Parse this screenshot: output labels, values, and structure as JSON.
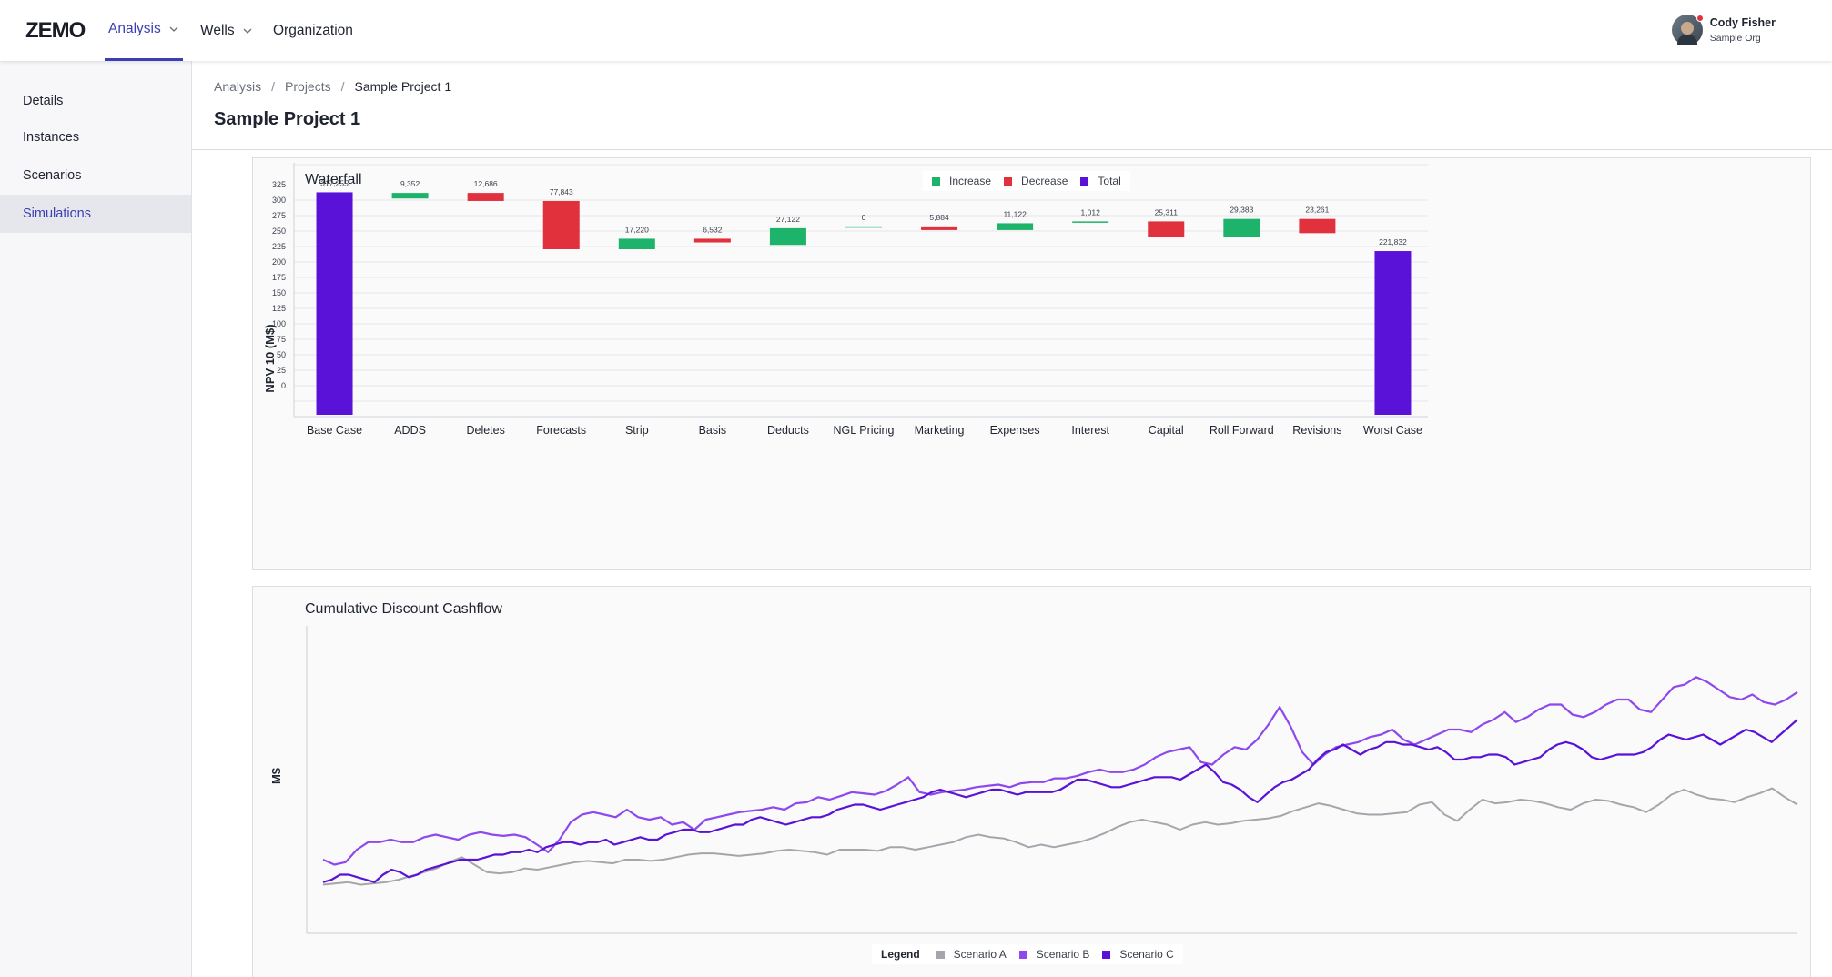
{
  "app": {
    "logo_text": "ZEMO"
  },
  "nav": {
    "analysis": "Analysis",
    "wells": "Wells",
    "organization": "Organization"
  },
  "user": {
    "name": "Cody Fisher",
    "org": "Sample Org"
  },
  "sidebar": {
    "items": [
      {
        "label": "Details"
      },
      {
        "label": "Instances"
      },
      {
        "label": "Scenarios"
      },
      {
        "label": "Simulations"
      }
    ]
  },
  "breadcrumb": {
    "items": [
      "Analysis",
      "Projects",
      "Sample Project 1"
    ],
    "separator": "/"
  },
  "page": {
    "title": "Sample Project 1"
  },
  "colors": {
    "increase": "#1eb36a",
    "decrease": "#e0313c",
    "total": "#5b12d8",
    "scenario_a": "#a4a6ac",
    "scenario_b": "#8e48ee",
    "scenario_c": "#5b12d8",
    "accent": "#3b3fb3"
  },
  "chart_data": [
    {
      "type": "bar",
      "subtype": "waterfall",
      "title": "Waterfall",
      "ylabel": "NPV 10 (M$)",
      "ylim": [
        -25,
        350
      ],
      "yticks": [
        0,
        25,
        50,
        75,
        100,
        125,
        150,
        175,
        200,
        225,
        250,
        275,
        300,
        325
      ],
      "grid": true,
      "legend": {
        "position": "top-center",
        "items": [
          "Increase",
          "Decrease",
          "Total"
        ]
      },
      "categories": [
        "Base Case",
        "ADDS",
        "Deletes",
        "Forecasts",
        "Strip",
        "Basis",
        "Deducts",
        "NGL Pricing",
        "Marketing",
        "Expenses",
        "Interest",
        "Capital",
        "Roll Forward",
        "Revisions",
        "Worst Case"
      ],
      "bars": [
        {
          "category": "Base Case",
          "kind": "Total",
          "start": -20,
          "end": 317,
          "label": "317,255"
        },
        {
          "category": "ADDS",
          "kind": "Increase",
          "start": 307,
          "end": 316,
          "label": "9,352"
        },
        {
          "category": "Deletes",
          "kind": "Decrease",
          "start": 316,
          "end": 303,
          "label": "12,686"
        },
        {
          "category": "Forecasts",
          "kind": "Decrease",
          "start": 303,
          "end": 225,
          "label": "77,843"
        },
        {
          "category": "Strip",
          "kind": "Increase",
          "start": 225,
          "end": 242,
          "label": "17,220"
        },
        {
          "category": "Basis",
          "kind": "Decrease",
          "start": 242,
          "end": 236,
          "label": "6,532"
        },
        {
          "category": "Deducts",
          "kind": "Increase",
          "start": 232,
          "end": 259,
          "label": "27,122"
        },
        {
          "category": "NGL Pricing",
          "kind": "Increase",
          "start": 262,
          "end": 262,
          "label": "0"
        },
        {
          "category": "Marketing",
          "kind": "Decrease",
          "start": 262,
          "end": 256,
          "label": "5,884"
        },
        {
          "category": "Expenses",
          "kind": "Increase",
          "start": 256,
          "end": 267,
          "label": "11,122"
        },
        {
          "category": "Interest",
          "kind": "Increase",
          "start": 269,
          "end": 270,
          "label": "1,012"
        },
        {
          "category": "Capital",
          "kind": "Decrease",
          "start": 270,
          "end": 245,
          "label": "25,311"
        },
        {
          "category": "Roll Forward",
          "kind": "Increase",
          "start": 245,
          "end": 274,
          "label": "29,383"
        },
        {
          "category": "Revisions",
          "kind": "Decrease",
          "start": 274,
          "end": 251,
          "label": "23,261"
        },
        {
          "category": "Worst Case",
          "kind": "Total",
          "start": -20,
          "end": 222,
          "label": "221,832"
        }
      ]
    },
    {
      "type": "line",
      "title": "Cumulative Discount Cashflow",
      "ylabel": "M$",
      "xlabel": "",
      "ylim": [
        0,
        100
      ],
      "grid": false,
      "legend": {
        "position": "bottom-center",
        "title": "Legend",
        "items": [
          "Scenario A",
          "Scenario B",
          "Scenario C"
        ]
      },
      "series": [
        {
          "name": "Scenario A",
          "values": [
            10,
            10.5,
            11,
            10,
            10.5,
            11,
            12,
            13.5,
            15,
            16.5,
            19,
            21,
            18,
            15,
            14.5,
            15,
            16.5,
            16,
            17,
            18,
            19,
            19.5,
            19,
            18.5,
            20,
            20,
            19.5,
            20,
            21,
            22,
            22.5,
            22.5,
            22,
            21.5,
            22,
            22.5,
            23.5,
            24,
            23.5,
            23,
            22,
            24,
            24,
            24,
            23.5,
            25,
            25,
            24,
            25,
            26,
            27,
            29,
            30,
            29,
            28.5,
            27,
            25,
            26,
            25,
            26,
            27,
            28.5,
            30.5,
            33,
            35,
            36,
            35,
            34,
            32,
            34,
            35,
            34,
            34.5,
            35.5,
            36,
            36.5,
            37.5,
            39.5,
            41,
            42.5,
            41.5,
            40,
            38.5,
            38,
            38,
            38.5,
            39,
            42,
            43,
            38,
            35.5,
            40,
            44,
            42.5,
            43,
            44,
            43.5,
            42.5,
            41,
            40,
            42.5,
            44,
            43.5,
            42,
            41,
            39,
            42,
            46,
            48,
            46,
            44.5,
            44,
            43,
            45,
            46.5,
            48.5,
            45,
            42
          ]
        },
        {
          "name": "Scenario B",
          "values": [
            20,
            18,
            19,
            24,
            27,
            27,
            28,
            27,
            27,
            29,
            30,
            29,
            28,
            30,
            31,
            30,
            29.5,
            30,
            29,
            26,
            23,
            28,
            35,
            38,
            39,
            38,
            37,
            40,
            37,
            36,
            37,
            34,
            35,
            32,
            36,
            37,
            38,
            39,
            39.5,
            40,
            41,
            40,
            42.5,
            43,
            45,
            44,
            45.5,
            47,
            46.5,
            46,
            47.5,
            50,
            53,
            47,
            46,
            47,
            47.5,
            48,
            49,
            49.5,
            50,
            49,
            50.5,
            51,
            51,
            52.5,
            52.5,
            53.5,
            55,
            56,
            55,
            55,
            56,
            58,
            61,
            63,
            64,
            65,
            59,
            58,
            62,
            65,
            64,
            68,
            74,
            81,
            73,
            63,
            58,
            62,
            65,
            66,
            67,
            69,
            70,
            72,
            68,
            66,
            68,
            70,
            72,
            72,
            71,
            74,
            76,
            79,
            75,
            77,
            80,
            82,
            82,
            78,
            77,
            79,
            82,
            84,
            84,
            80,
            79,
            84,
            89,
            90,
            93,
            91,
            88,
            85,
            84,
            86,
            83,
            82,
            84,
            87
          ]
        },
        {
          "name": "Scenario C",
          "values": [
            11,
            12,
            14,
            14,
            13,
            12,
            11,
            14,
            16,
            15,
            13,
            14,
            16,
            17,
            18,
            19,
            20,
            20,
            20,
            21,
            22,
            22,
            23,
            23,
            24,
            23,
            25,
            26,
            27,
            27,
            26,
            27,
            27,
            28,
            26,
            27,
            28,
            29,
            28,
            28,
            30,
            31,
            32,
            32,
            31,
            31,
            32,
            33,
            34,
            34,
            36,
            37,
            36,
            35,
            34,
            35,
            36,
            37,
            37,
            38,
            40,
            41,
            42,
            42,
            41,
            40,
            41,
            42,
            43,
            44,
            45,
            47,
            48,
            47,
            46,
            45,
            46,
            47,
            48,
            48,
            47,
            46,
            47,
            47,
            47,
            47,
            48,
            50,
            52,
            52,
            51,
            50,
            49,
            49,
            50,
            51,
            52,
            53,
            53,
            53,
            52,
            54,
            56,
            58,
            55,
            51,
            50,
            48,
            45,
            43,
            46,
            49,
            51,
            52,
            54,
            56,
            60,
            63,
            64,
            66,
            64,
            62,
            64,
            65,
            67,
            67,
            66,
            66,
            65,
            64,
            65,
            63,
            60,
            60,
            61,
            61,
            62,
            62,
            61,
            58,
            59,
            60,
            61,
            64,
            66,
            67,
            66,
            64,
            61,
            60,
            61,
            62,
            62,
            62,
            63,
            65,
            68,
            70,
            69,
            68,
            69,
            70,
            68,
            66,
            68,
            70,
            72,
            71,
            69,
            67,
            70,
            73,
            76
          ]
        }
      ]
    }
  ]
}
